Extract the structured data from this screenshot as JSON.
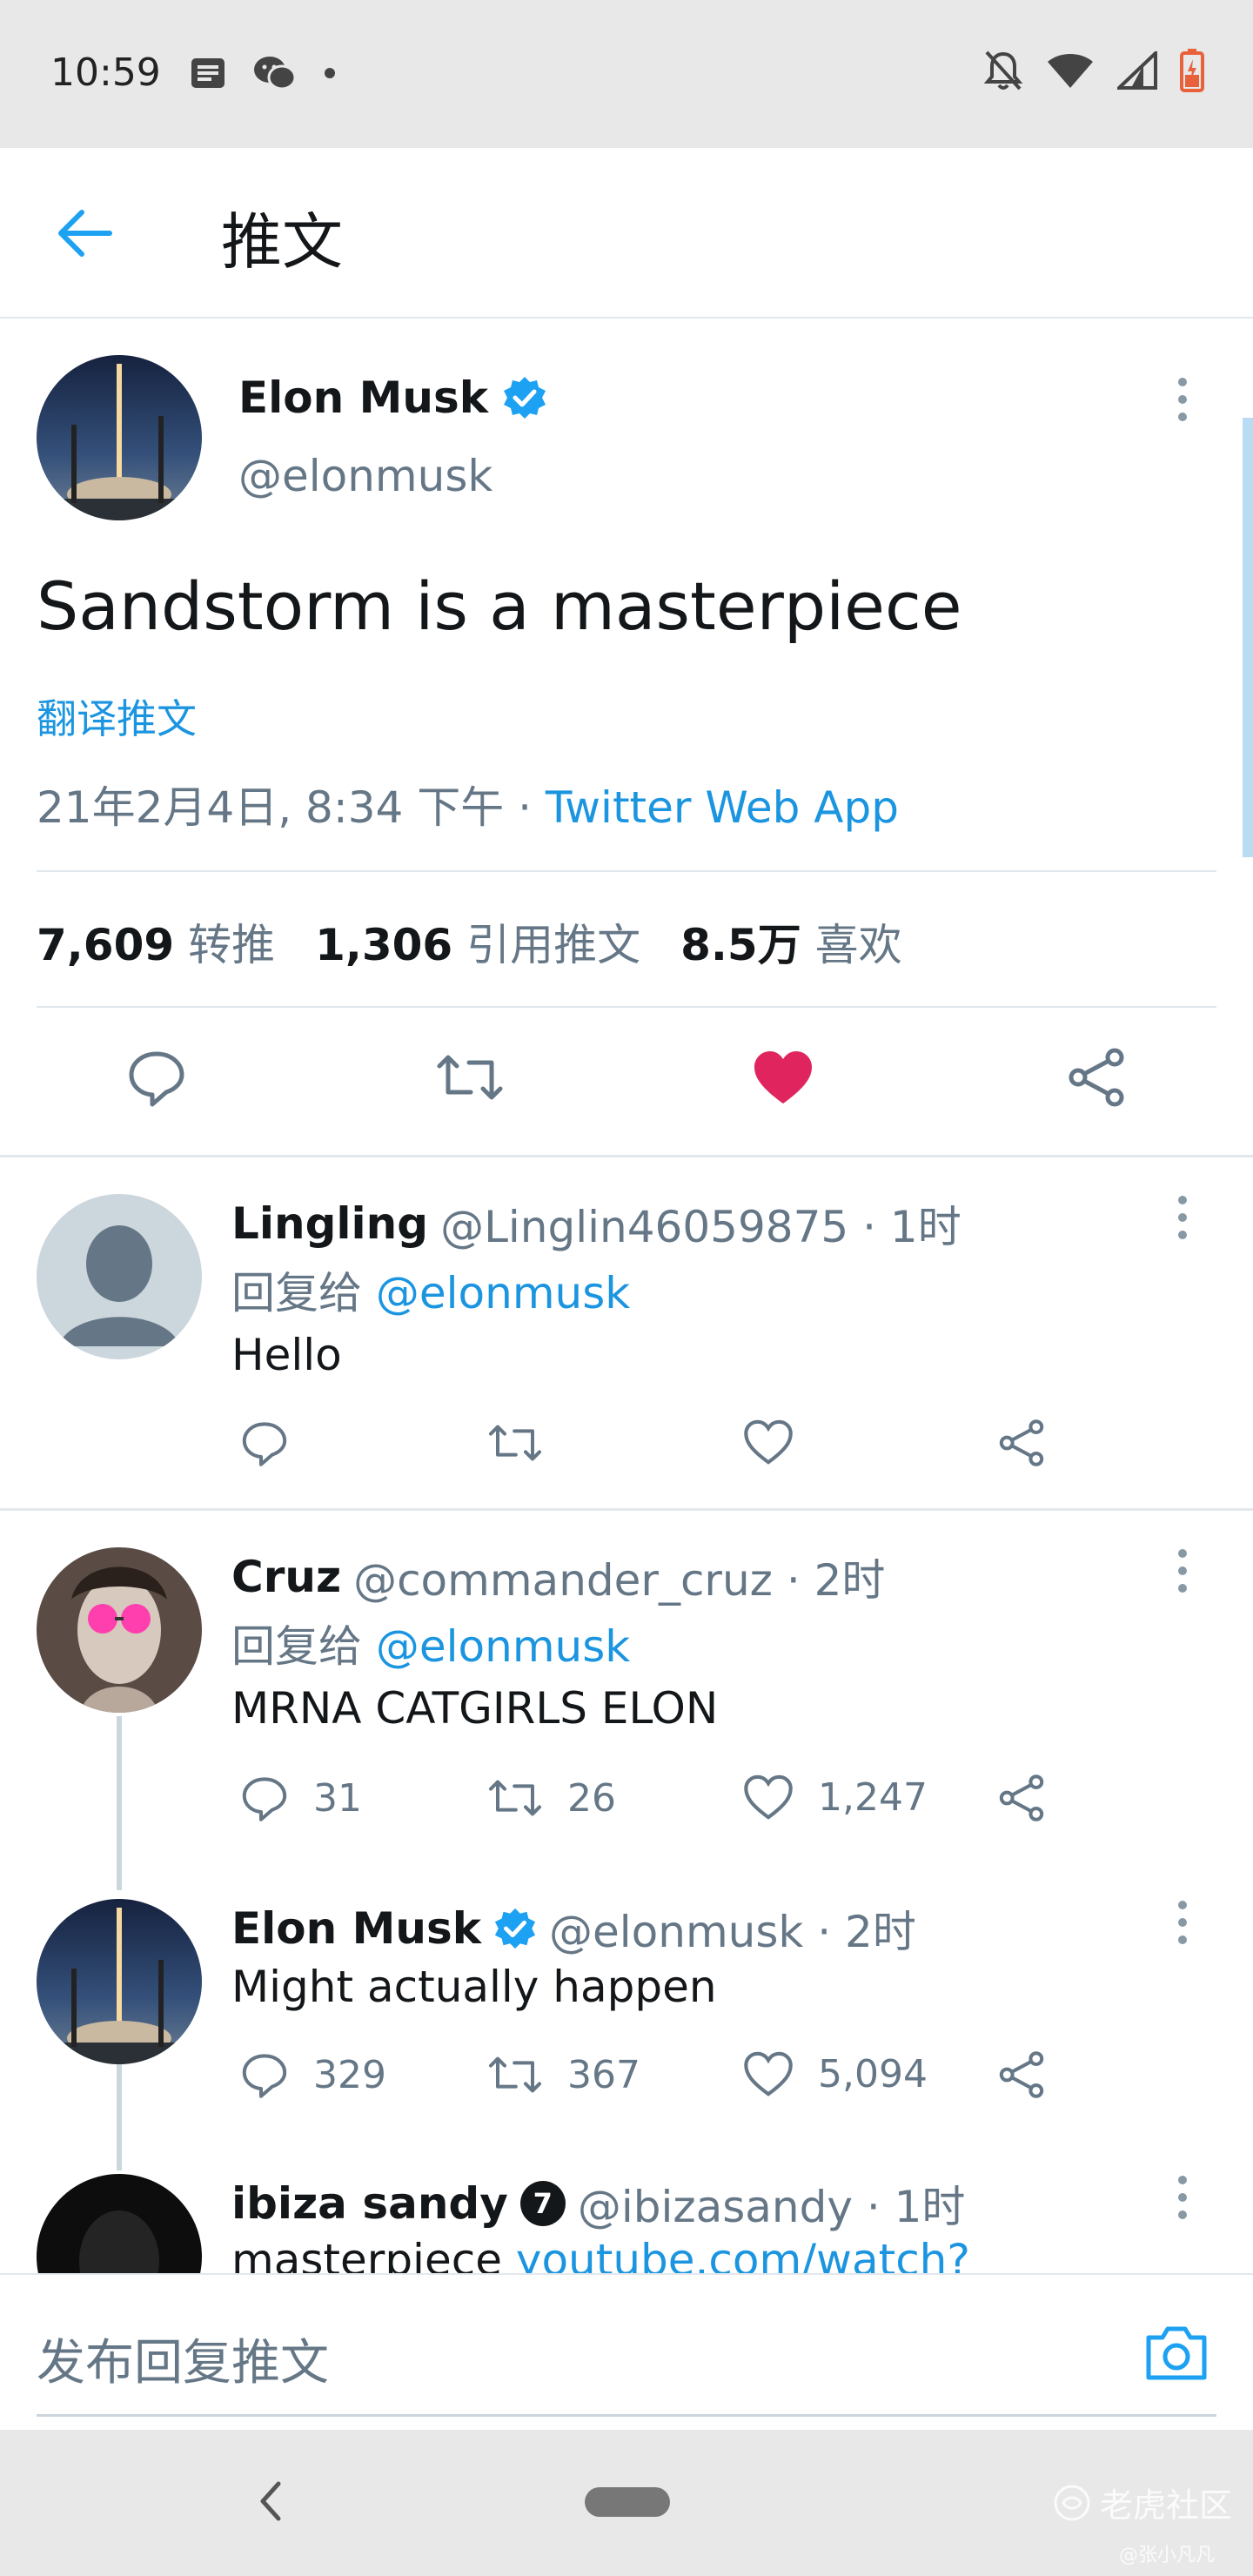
{
  "status_bar": {
    "time": "10:59"
  },
  "header": {
    "title": "推文"
  },
  "main_tweet": {
    "name": "Elon Musk",
    "handle": "@elonmusk",
    "text": "Sandstorm is a masterpiece",
    "translate": "翻译推文",
    "timestamp": "21年2月4日, 8:34 下午 · ",
    "source": "Twitter Web App",
    "stats": {
      "retweets_count": "7,609",
      "retweets_label": "转推",
      "quotes_count": "1,306",
      "quotes_label": "引用推文",
      "likes_count": "8.5万",
      "likes_label": "喜欢"
    },
    "liked": true,
    "colors": {
      "like": "#e0245e",
      "link": "#1b95e0",
      "verified": "#1da1f2"
    }
  },
  "replies": [
    {
      "name": "Lingling",
      "handle": "@Linglin46059875 · 1时",
      "reply_prefix": "回复给 ",
      "reply_to": "@elonmusk",
      "text": "Hello",
      "counts": {
        "reply": "",
        "retweet": "",
        "like": ""
      }
    },
    {
      "name": "Cruz",
      "handle": "@commander_cruz · 2时",
      "reply_prefix": "回复给 ",
      "reply_to": "@elonmusk",
      "text": "MRNA CATGIRLS ELON",
      "counts": {
        "reply": "31",
        "retweet": "26",
        "like": "1,247"
      }
    },
    {
      "name": "Elon Musk",
      "handle": "@elonmusk · 2时",
      "text": "Might actually happen",
      "counts": {
        "reply": "329",
        "retweet": "367",
        "like": "5,094"
      }
    },
    {
      "name": "ibiza sandy",
      "badge": "7",
      "handle": "@ibizasandy · 1时",
      "text_prefix": "masterpiece ",
      "link": "youtube.com/watch?"
    }
  ],
  "compose": {
    "placeholder": "发布回复推文"
  },
  "watermark": {
    "main": "老虎社区",
    "sub": "@张小凡凡"
  }
}
